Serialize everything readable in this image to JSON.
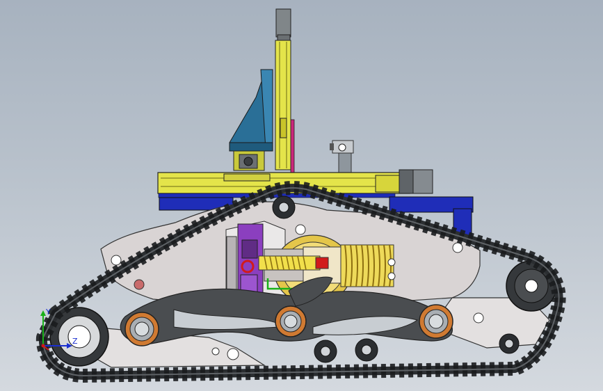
{
  "viewport": {
    "background_top": "#a7b2bf",
    "background_bottom": "#d4d9df"
  },
  "model": {
    "subject": "tracked-robot-assembly",
    "parts": [
      "track-belt",
      "rear-sprocket",
      "front-idler",
      "road-wheels",
      "side-plate",
      "suspension-arm",
      "spring-damper",
      "compression-spring",
      "linear-rail-horizontal",
      "linear-rail-vertical",
      "stepper-motor",
      "blue-mount-block",
      "navy-support-bracket",
      "purple-bracket"
    ],
    "colors": {
      "track": "#2b2e31",
      "side_plate": "#d9d4d4",
      "arm": "#4a4d50",
      "bearing": "#d07a32",
      "spring": "#e6d53a",
      "rail": "#e4e44a",
      "mount_block": "#2a6f97",
      "support": "#1f2db8",
      "purple": "#8b3fbf",
      "red_handle": "#d11b1b"
    }
  },
  "triad": {
    "axis_y_label": "Y",
    "axis_z_label": "Z",
    "x_color": "#d01818",
    "y_color": "#18b018",
    "z_color": "#1a2fd0"
  }
}
